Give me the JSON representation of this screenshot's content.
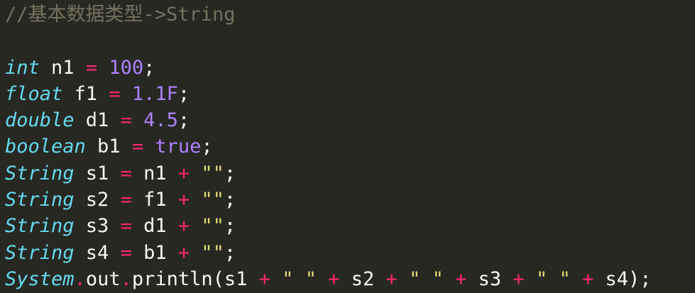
{
  "editor": {
    "lines": [
      [
        {
          "t": "cm",
          "v": "//基本数据类型->String"
        }
      ],
      [],
      [
        {
          "t": "kw",
          "v": "int"
        },
        {
          "t": "pl",
          "v": " n1 "
        },
        {
          "t": "op",
          "v": "="
        },
        {
          "t": "pl",
          "v": " "
        },
        {
          "t": "num",
          "v": "100"
        },
        {
          "t": "pl",
          "v": ";"
        }
      ],
      [
        {
          "t": "kw",
          "v": "float"
        },
        {
          "t": "pl",
          "v": " f1 "
        },
        {
          "t": "op",
          "v": "="
        },
        {
          "t": "pl",
          "v": " "
        },
        {
          "t": "num",
          "v": "1.1F"
        },
        {
          "t": "pl",
          "v": ";"
        }
      ],
      [
        {
          "t": "kw",
          "v": "double"
        },
        {
          "t": "pl",
          "v": " d1 "
        },
        {
          "t": "op",
          "v": "="
        },
        {
          "t": "pl",
          "v": " "
        },
        {
          "t": "num",
          "v": "4.5"
        },
        {
          "t": "pl",
          "v": ";"
        }
      ],
      [
        {
          "t": "kw",
          "v": "boolean"
        },
        {
          "t": "pl",
          "v": " b1 "
        },
        {
          "t": "op",
          "v": "="
        },
        {
          "t": "pl",
          "v": " "
        },
        {
          "t": "num",
          "v": "true"
        },
        {
          "t": "pl",
          "v": ";"
        }
      ],
      [
        {
          "t": "kw",
          "v": "String"
        },
        {
          "t": "pl",
          "v": " s1 "
        },
        {
          "t": "op",
          "v": "="
        },
        {
          "t": "pl",
          "v": " n1 "
        },
        {
          "t": "op",
          "v": "+"
        },
        {
          "t": "pl",
          "v": " "
        },
        {
          "t": "str",
          "v": "\"\""
        },
        {
          "t": "pl",
          "v": ";"
        }
      ],
      [
        {
          "t": "kw",
          "v": "String"
        },
        {
          "t": "pl",
          "v": " s2 "
        },
        {
          "t": "op",
          "v": "="
        },
        {
          "t": "pl",
          "v": " f1 "
        },
        {
          "t": "op",
          "v": "+"
        },
        {
          "t": "pl",
          "v": " "
        },
        {
          "t": "str",
          "v": "\"\""
        },
        {
          "t": "pl",
          "v": ";"
        }
      ],
      [
        {
          "t": "kw",
          "v": "String"
        },
        {
          "t": "pl",
          "v": " s3 "
        },
        {
          "t": "op",
          "v": "="
        },
        {
          "t": "pl",
          "v": " d1 "
        },
        {
          "t": "op",
          "v": "+"
        },
        {
          "t": "pl",
          "v": " "
        },
        {
          "t": "str",
          "v": "\"\""
        },
        {
          "t": "pl",
          "v": ";"
        }
      ],
      [
        {
          "t": "kw",
          "v": "String"
        },
        {
          "t": "pl",
          "v": " s4 "
        },
        {
          "t": "op",
          "v": "="
        },
        {
          "t": "pl",
          "v": " b1 "
        },
        {
          "t": "op",
          "v": "+"
        },
        {
          "t": "pl",
          "v": " "
        },
        {
          "t": "str",
          "v": "\"\""
        },
        {
          "t": "pl",
          "v": ";"
        }
      ],
      [
        {
          "t": "kw",
          "v": "System"
        },
        {
          "t": "op",
          "v": "."
        },
        {
          "t": "pl",
          "v": "out"
        },
        {
          "t": "op",
          "v": "."
        },
        {
          "t": "pl",
          "v": "println(s1 "
        },
        {
          "t": "op",
          "v": "+"
        },
        {
          "t": "pl",
          "v": " "
        },
        {
          "t": "str",
          "v": "\" \""
        },
        {
          "t": "pl",
          "v": " "
        },
        {
          "t": "op",
          "v": "+"
        },
        {
          "t": "pl",
          "v": " s2 "
        },
        {
          "t": "op",
          "v": "+"
        },
        {
          "t": "pl",
          "v": " "
        },
        {
          "t": "str",
          "v": "\" \""
        },
        {
          "t": "pl",
          "v": " "
        },
        {
          "t": "op",
          "v": "+"
        },
        {
          "t": "pl",
          "v": " s3 "
        },
        {
          "t": "op",
          "v": "+"
        },
        {
          "t": "pl",
          "v": " "
        },
        {
          "t": "str",
          "v": "\" \""
        },
        {
          "t": "pl",
          "v": " "
        },
        {
          "t": "op",
          "v": "+"
        },
        {
          "t": "pl",
          "v": " s4);"
        }
      ]
    ]
  },
  "colors": {
    "background": "#272822",
    "comment": "#75715e",
    "keyword": "#66d9ef",
    "operator": "#f92672",
    "number": "#ae81ff",
    "string": "#e6db74",
    "plain": "#f8f8f2"
  }
}
